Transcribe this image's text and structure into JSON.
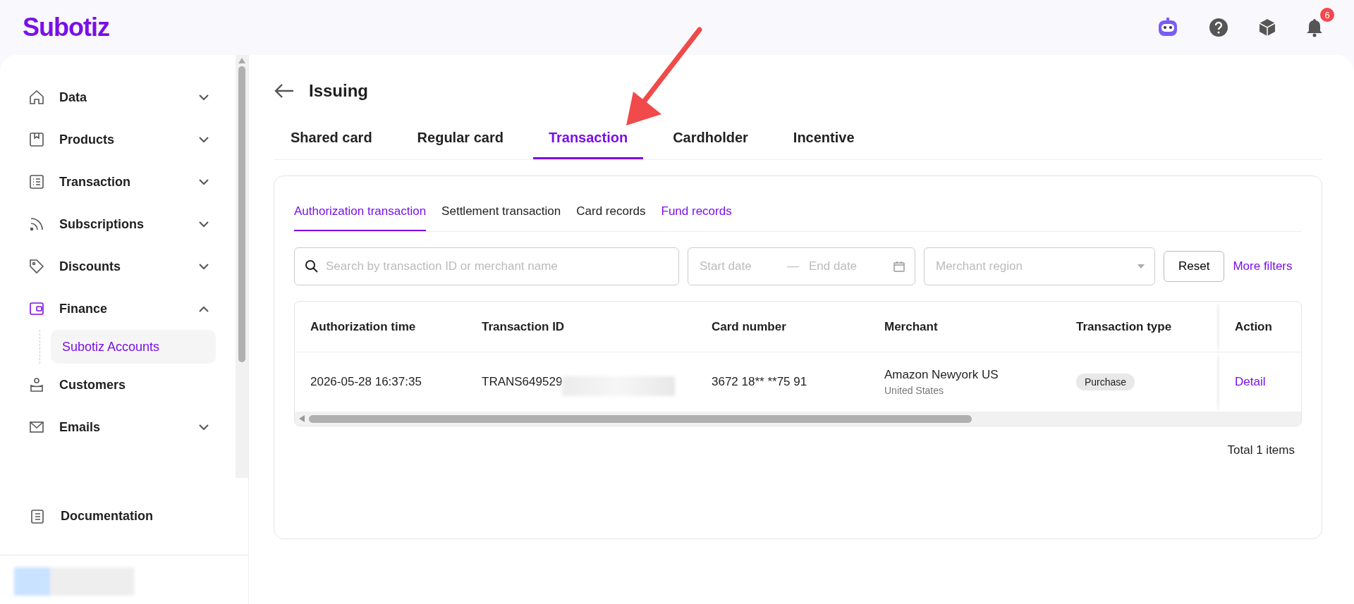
{
  "header": {
    "logo": "Subotiz",
    "notification_count": "6"
  },
  "sidebar": {
    "items": [
      {
        "label": "Data",
        "expanded": false
      },
      {
        "label": "Products",
        "expanded": false
      },
      {
        "label": "Transaction",
        "expanded": false
      },
      {
        "label": "Subscriptions",
        "expanded": false
      },
      {
        "label": "Discounts",
        "expanded": false
      },
      {
        "label": "Finance",
        "expanded": true,
        "selected": true,
        "children": [
          {
            "label": "Subotiz Accounts",
            "selected": true
          }
        ]
      },
      {
        "label": "Customers",
        "selected": false
      },
      {
        "label": "Emails",
        "expanded": false
      }
    ],
    "footer_link": "Documentation"
  },
  "page": {
    "title": "Issuing",
    "tabs": [
      {
        "label": "Shared card",
        "selected": false
      },
      {
        "label": "Regular card",
        "selected": false
      },
      {
        "label": "Transaction",
        "selected": true
      },
      {
        "label": "Cardholder",
        "selected": false
      },
      {
        "label": "Incentive",
        "selected": false
      }
    ],
    "subtabs": [
      {
        "label": "Authorization transaction",
        "selected": true,
        "hovered": false
      },
      {
        "label": "Settlement transaction",
        "selected": false,
        "hovered": false
      },
      {
        "label": "Card records",
        "selected": false,
        "hovered": false
      },
      {
        "label": "Fund records",
        "selected": false,
        "hovered": true
      }
    ],
    "filters": {
      "search": {
        "placeholder": "Search by transaction ID or merchant name"
      },
      "start_date": {
        "placeholder": "Start date"
      },
      "date_separator": "—",
      "end_date": {
        "placeholder": "End date"
      },
      "region": {
        "placeholder": "Merchant region"
      },
      "reset": "Reset",
      "more_filters": "More filters"
    },
    "table": {
      "columns": [
        "Authorization time",
        "Transaction ID",
        "Card number",
        "Merchant",
        "Transaction type",
        "Action"
      ],
      "rows": [
        {
          "authorization_time": "2026-05-28 16:37:35",
          "transaction_id": "TRANS649529",
          "card_number": "3672 18** **75 91",
          "merchant": "Amazon Newyork US",
          "merchant_region": "United States",
          "transaction_type": "Purchase",
          "action": "Detail"
        }
      ]
    },
    "total": "Total 1 items"
  }
}
